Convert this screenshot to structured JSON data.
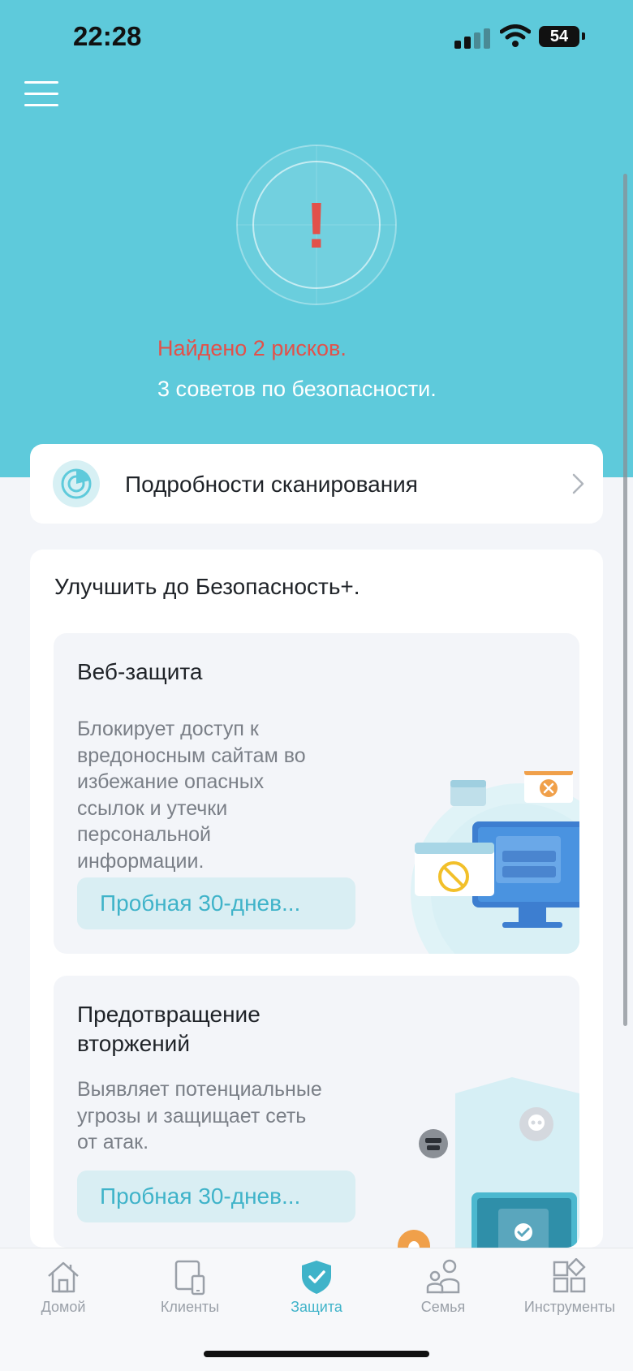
{
  "status_bar": {
    "time": "22:28",
    "battery": "54"
  },
  "scan": {
    "alert_symbol": "!",
    "risks": "Найдено 2 рисков.",
    "tips": "3 советов по безопасности."
  },
  "scan_details": {
    "label": "Подробности сканирования",
    "icon": "radar-icon"
  },
  "upgrade": {
    "title": "Улучшить до Безопасность+.",
    "features": [
      {
        "title": "Веб-защита",
        "description_lines": [
          "Блокирует доступ к",
          "вредоносным сайтам во",
          "избежание опасных",
          "ссылок и утечки",
          "персональной",
          "информации."
        ],
        "button": "Пробная 30-днев..."
      },
      {
        "title_lines": [
          "Предотвращение",
          "вторжений"
        ],
        "description_lines": [
          "Выявляет потенциальные",
          "угрозы и защищает сеть",
          "от атак."
        ],
        "button": "Пробная 30-днев..."
      }
    ]
  },
  "tabs": [
    {
      "label": "Домой",
      "icon": "home-icon",
      "active": false
    },
    {
      "label": "Клиенты",
      "icon": "devices-icon",
      "active": false
    },
    {
      "label": "Защита",
      "icon": "shield-icon",
      "active": true
    },
    {
      "label": "Семья",
      "icon": "family-icon",
      "active": false
    },
    {
      "label": "Инструменты",
      "icon": "tools-icon",
      "active": false
    }
  ],
  "colors": {
    "hero": "#5ecadb",
    "accent": "#3fb3c9",
    "alert": "#e2514a",
    "background": "#f3f5f9"
  }
}
